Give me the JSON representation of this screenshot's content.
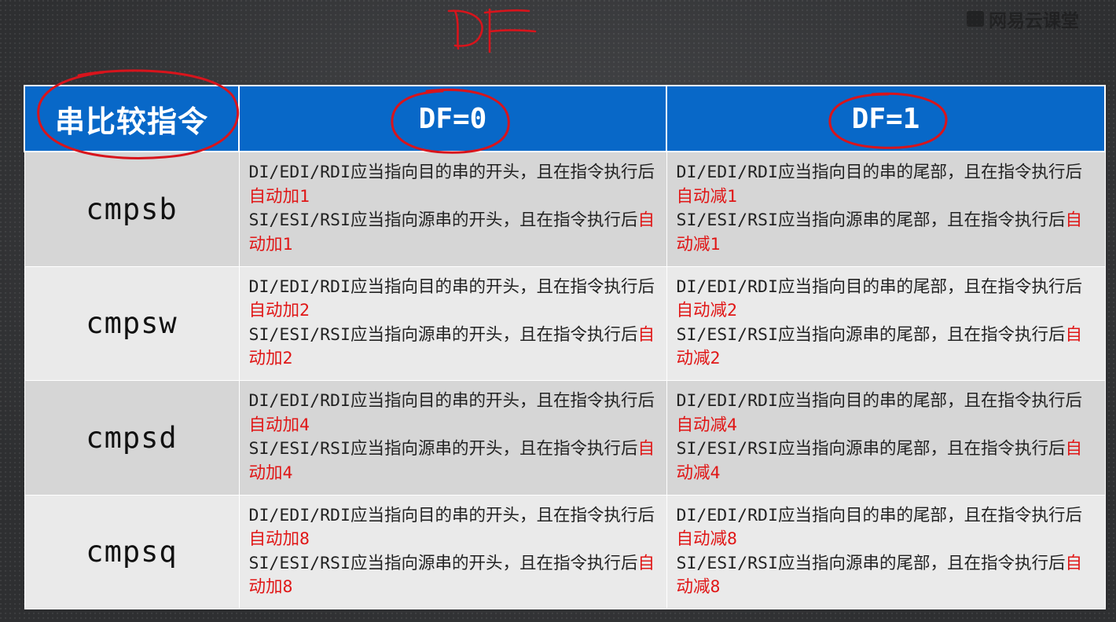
{
  "watermark": {
    "text": "网易云课堂"
  },
  "annotation": {
    "text": "DF"
  },
  "table": {
    "headers": [
      "串比较指令",
      "DF=0",
      "DF=1"
    ],
    "rows": [
      {
        "instruction": "cmpsb",
        "df0": {
          "di_text": "DI/EDI/RDI应当指向目的串的开头，且在指令执行后",
          "di_action": "自动加1",
          "si_text": "SI/ESI/RSI应当指向源串的开头，且在指令执行后",
          "si_action": "自动加1"
        },
        "df1": {
          "di_text": "DI/EDI/RDI应当指向目的串的尾部，且在指令执行后",
          "di_action": "自动减1",
          "si_text": "SI/ESI/RSI应当指向源串的尾部，且在指令执行后",
          "si_action": "自动减1"
        }
      },
      {
        "instruction": "cmpsw",
        "df0": {
          "di_text": "DI/EDI/RDI应当指向目的串的开头，且在指令执行后",
          "di_action": "自动加2",
          "si_text": "SI/ESI/RSI应当指向源串的开头，且在指令执行后",
          "si_action": "自动加2"
        },
        "df1": {
          "di_text": "DI/EDI/RDI应当指向目的串的尾部，且在指令执行后",
          "di_action": "自动减2",
          "si_text": "SI/ESI/RSI应当指向源串的尾部，且在指令执行后",
          "si_action": "自动减2"
        }
      },
      {
        "instruction": "cmpsd",
        "df0": {
          "di_text": "DI/EDI/RDI应当指向目的串的开头，且在指令执行后",
          "di_action": "自动加4",
          "si_text": "SI/ESI/RSI应当指向源串的开头，且在指令执行后",
          "si_action": "自动加4"
        },
        "df1": {
          "di_text": "DI/EDI/RDI应当指向目的串的尾部，且在指令执行后",
          "di_action": "自动减4",
          "si_text": "SI/ESI/RSI应当指向源串的尾部，且在指令执行后",
          "si_action": "自动减4"
        }
      },
      {
        "instruction": "cmpsq",
        "df0": {
          "di_text": "DI/EDI/RDI应当指向目的串的开头，且在指令执行后",
          "di_action": "自动加8",
          "si_text": "SI/ESI/RSI应当指向源串的开头，且在指令执行后",
          "si_action": "自动加8"
        },
        "df1": {
          "di_text": "DI/EDI/RDI应当指向目的串的尾部，且在指令执行后",
          "di_action": "自动减8",
          "si_text": "SI/ESI/RSI应当指向源串的尾部，且在指令执行后",
          "si_action": "自动减8"
        }
      }
    ]
  },
  "colors": {
    "header_bg": "#0868c8",
    "header_text": "#ffffff",
    "row_odd_bg": "#d6d6d6",
    "row_even_bg": "#eaeaea",
    "highlight_text": "#e01616",
    "annotation_ink": "#d8141c"
  }
}
